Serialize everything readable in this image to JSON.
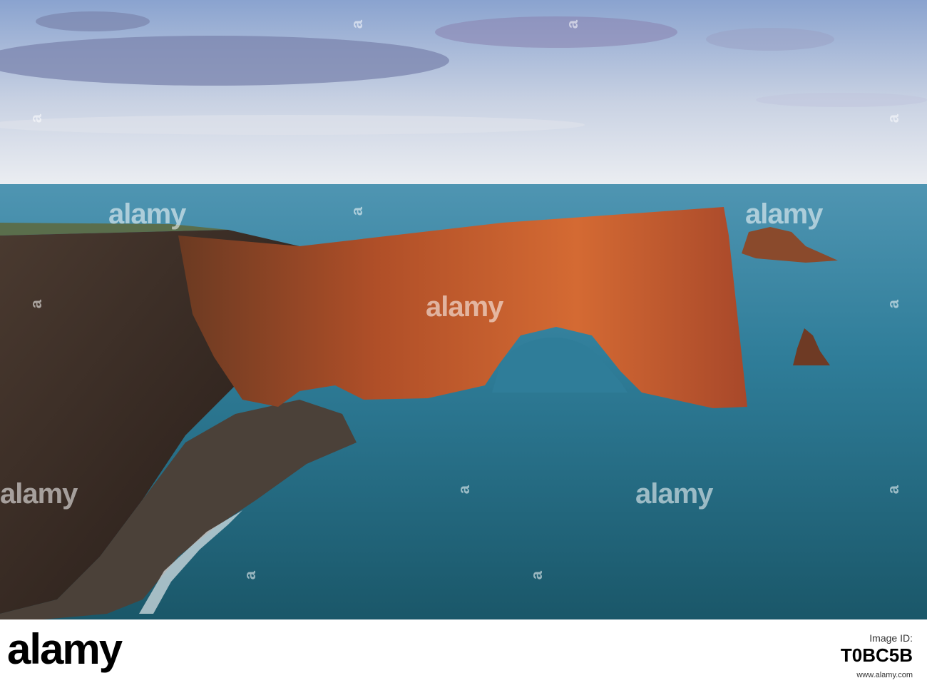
{
  "watermark": {
    "text": "alamy",
    "small_text": "a"
  },
  "footer": {
    "brand": "alamy",
    "tagline": "",
    "image_id_label": "Image ID:",
    "image_id": "T0BC5B",
    "url": "www.alamy.com"
  },
  "colors": {
    "sky_top": "#8fa6cf",
    "sky_horizon": "#e6e8ee",
    "sea_far": "#3f8aa8",
    "sea_near": "#1d5f73",
    "rock_lit": "#c8552a",
    "rock_shadow": "#3b2a22"
  }
}
